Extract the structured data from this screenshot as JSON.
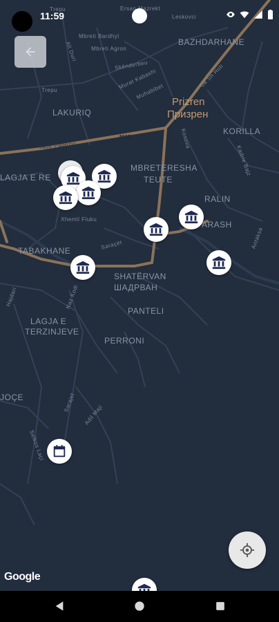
{
  "status_bar": {
    "time": "11:59"
  },
  "map": {
    "city_name_latin": "Prizren",
    "city_name_cyrillic": "Призрен",
    "areas": {
      "bazhdarhane": "BAZHDARHANE",
      "lakuriq": "LAKURIQ",
      "korilla": "KORILLA",
      "mbreteresha": "MBRETERESHA",
      "teute": "TEUTE",
      "lagja_e_re": "LAGJA E RE",
      "ralin": "RALIN",
      "arash": "ARASH",
      "tabakhane": "TABAKHANE",
      "shatervan_latin": "SHATËRVAN",
      "shatervan_cyrillic": "ШАДРВАН",
      "panteli": "PANTELI",
      "lagja_e": "LAGJA E",
      "terzinjeve": "TERZINJEVE",
      "perroni": "PERRONI",
      "joce": "JOÇE"
    },
    "streets": {
      "ersan": "Ersan Mazrekt",
      "mbreti": "Mbreti Bardhyl",
      "mbreti_agron": "Mbreti Agron",
      "skenderbeu": "Skënderbeu",
      "murat": "Murat Kabashi",
      "muhabibet": "Muhabibet",
      "leskovci": "Leskovci",
      "ukshin": "Uk Sh Hoti",
      "tabe": "Tabe Paqezio",
      "m25": "M25",
      "kosova": "Kosova",
      "kadrie": "Kadrie Bajz",
      "xhemil": "Xhemil Fluku",
      "saraqet": "Saraçët",
      "naz": "Naz Kodi",
      "hajdari": "Hajdari",
      "adil": "Adil Maji",
      "sarajet": "Sarajet",
      "selkos": "Selkos Laçi",
      "trepu": "Trepu",
      "ali": "Ali Duri",
      "antakse": "Antaksa"
    },
    "markers": [
      {
        "type": "museum-icon"
      },
      {
        "type": "museum-icon"
      },
      {
        "type": "museum-icon"
      },
      {
        "type": "museum-icon"
      },
      {
        "type": "museum-icon"
      },
      {
        "type": "museum-icon"
      },
      {
        "type": "museum-icon"
      },
      {
        "type": "calendar-icon"
      },
      {
        "type": "museum-icon"
      }
    ],
    "attribution": "Google"
  },
  "colors": {
    "map_bg": "#222d3e",
    "major_road": "#8a7358",
    "minor_road": "#334155",
    "marker_icon": "#1e2a52",
    "city_label": "#c49a6c"
  }
}
